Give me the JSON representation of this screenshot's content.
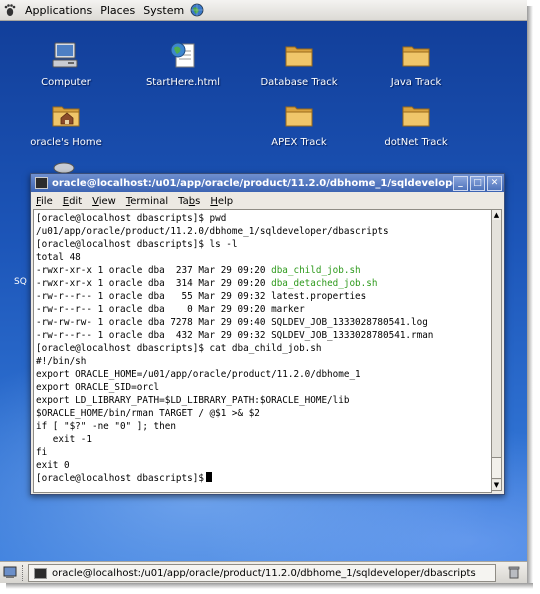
{
  "top_panel": {
    "menus": [
      "Applications",
      "Places",
      "System"
    ],
    "icons": [
      "gnome-foot-icon",
      "globe-browser-icon"
    ]
  },
  "desktop": {
    "icons": [
      {
        "label": "Computer",
        "icon": "computer-icon"
      },
      {
        "label": "StartHere.html",
        "icon": "html-file-icon"
      },
      {
        "label": "Database Track",
        "icon": "folder-icon"
      },
      {
        "label": "Java Track",
        "icon": "folder-icon"
      },
      {
        "label": "oracle's Home",
        "icon": "home-folder-icon"
      },
      {
        "label": "APEX Track",
        "icon": "folder-icon"
      },
      {
        "label": "dotNet Track",
        "icon": "folder-icon"
      }
    ],
    "partial_label": "SQ"
  },
  "terminal": {
    "title": "oracle@localhost:/u01/app/oracle/product/11.2.0/dbhome_1/sqldevelope",
    "menu": [
      {
        "key": "F",
        "rest": "ile"
      },
      {
        "key": "E",
        "rest": "dit"
      },
      {
        "key": "V",
        "rest": "iew"
      },
      {
        "key": "T",
        "rest": "erminal"
      },
      {
        "pre": "Ta",
        "key": "b",
        "rest": "s"
      },
      {
        "key": "H",
        "rest": "elp"
      }
    ],
    "lines": [
      {
        "text": "[oracle@localhost dbascripts]$ pwd"
      },
      {
        "text": "/u01/app/oracle/product/11.2.0/dbhome_1/sqldeveloper/dbascripts"
      },
      {
        "text": "[oracle@localhost dbascripts]$ ls -l"
      },
      {
        "text": "total 48"
      },
      {
        "text": "-rwxr-xr-x 1 oracle dba  237 Mar 29 09:20 ",
        "hl": "dba_child_job.sh"
      },
      {
        "text": "-rwxr-xr-x 1 oracle dba  314 Mar 29 09:20 ",
        "hl": "dba_detached_job.sh"
      },
      {
        "text": "-rw-r--r-- 1 oracle dba   55 Mar 29 09:32 latest.properties"
      },
      {
        "text": "-rw-r--r-- 1 oracle dba    0 Mar 29 09:20 marker"
      },
      {
        "text": "-rw-rw-rw- 1 oracle dba 7278 Mar 29 09:40 SQLDEV_JOB_1333028780541.log"
      },
      {
        "text": "-rw-r--r-- 1 oracle dba  432 Mar 29 09:32 SQLDEV_JOB_1333028780541.rman"
      },
      {
        "text": "[oracle@localhost dbascripts]$ cat dba_child_job.sh"
      },
      {
        "text": "#!/bin/sh"
      },
      {
        "text": "export ORACLE_HOME=/u01/app/oracle/product/11.2.0/dbhome_1"
      },
      {
        "text": "export ORACLE_SID=orcl"
      },
      {
        "text": "export LD_LIBRARY_PATH=$LD_LIBRARY_PATH:$ORACLE_HOME/lib"
      },
      {
        "text": "$ORACLE_HOME/bin/rman TARGET / @$1 >& $2"
      },
      {
        "text": "if [ \"$?\" -ne \"0\" ]; then"
      },
      {
        "text": "   exit -1"
      },
      {
        "text": "fi"
      },
      {
        "text": "exit 0"
      },
      {
        "text": "[oracle@localhost dbascripts]$"
      }
    ],
    "colors": {
      "highlight": "#2e9a1c",
      "title_bar": "#4a6fb8"
    }
  },
  "taskbar": {
    "task_label": "oracle@localhost:/u01/app/oracle/product/11.2.0/dbhome_1/sqldeveloper/dbascripts"
  }
}
